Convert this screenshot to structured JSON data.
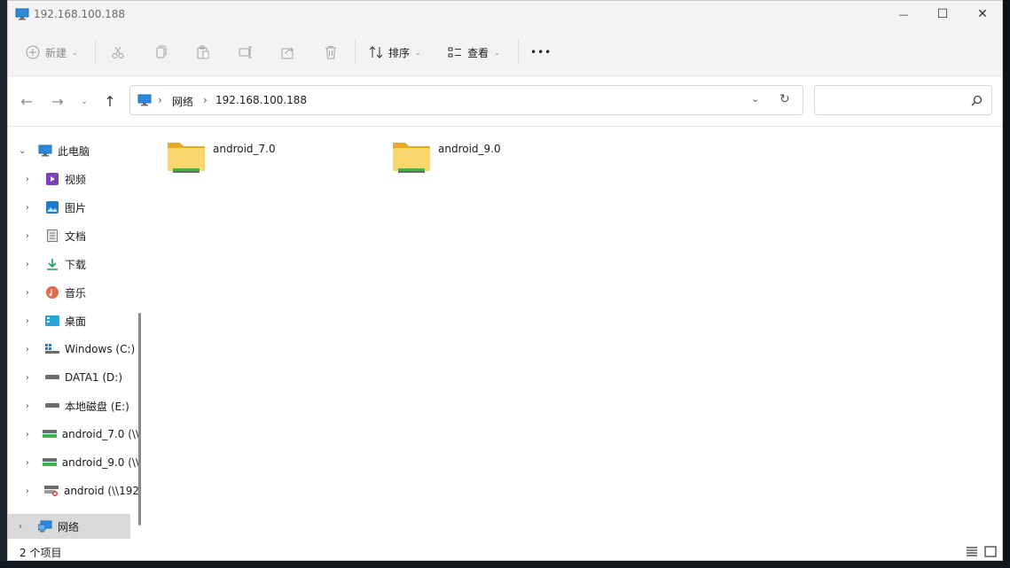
{
  "window": {
    "title": "192.168.100.188",
    "controls": {
      "minimize": "—",
      "maximize": "☐",
      "close": "✕"
    }
  },
  "toolbar": {
    "new_label": "新建",
    "sort_label": "排序",
    "view_label": "查看",
    "more_label": "•••",
    "icons": [
      "cut-icon",
      "copy-icon",
      "paste-icon",
      "rename-icon",
      "share-icon",
      "delete-icon"
    ]
  },
  "address_bar": {
    "breadcrumbs": [
      "网络",
      "192.168.100.188"
    ],
    "separator": "›"
  },
  "search": {
    "placeholder": ""
  },
  "sidebar": {
    "items": [
      {
        "label": "此电脑",
        "icon": "computer-icon",
        "expanded": true
      },
      {
        "label": "视频",
        "icon": "video-icon"
      },
      {
        "label": "图片",
        "icon": "pictures-icon"
      },
      {
        "label": "文档",
        "icon": "documents-icon"
      },
      {
        "label": "下载",
        "icon": "download-icon"
      },
      {
        "label": "音乐",
        "icon": "music-icon"
      },
      {
        "label": "桌面",
        "icon": "desktop-icon"
      },
      {
        "label": "Windows (C:)",
        "icon": "drive-c-icon"
      },
      {
        "label": "DATA1 (D:)",
        "icon": "drive-icon"
      },
      {
        "label": "本地磁盘 (E:)",
        "icon": "drive-icon"
      },
      {
        "label": "android_7.0 (\\\\",
        "icon": "network-drive-icon"
      },
      {
        "label": "android_9.0 (\\\\",
        "icon": "network-drive-icon"
      },
      {
        "label": "android (\\\\192",
        "icon": "network-drive-disconnected-icon"
      },
      {
        "label": "网络",
        "icon": "network-icon",
        "selected": true
      }
    ]
  },
  "content": {
    "folders": [
      {
        "name": "android_7.0"
      },
      {
        "name": "android_9.0"
      }
    ]
  },
  "status": {
    "item_count": "2 个项目"
  },
  "colors": {
    "accent": "#0067c0",
    "folder": "#f6c94a",
    "share_green": "#3bb54a"
  }
}
